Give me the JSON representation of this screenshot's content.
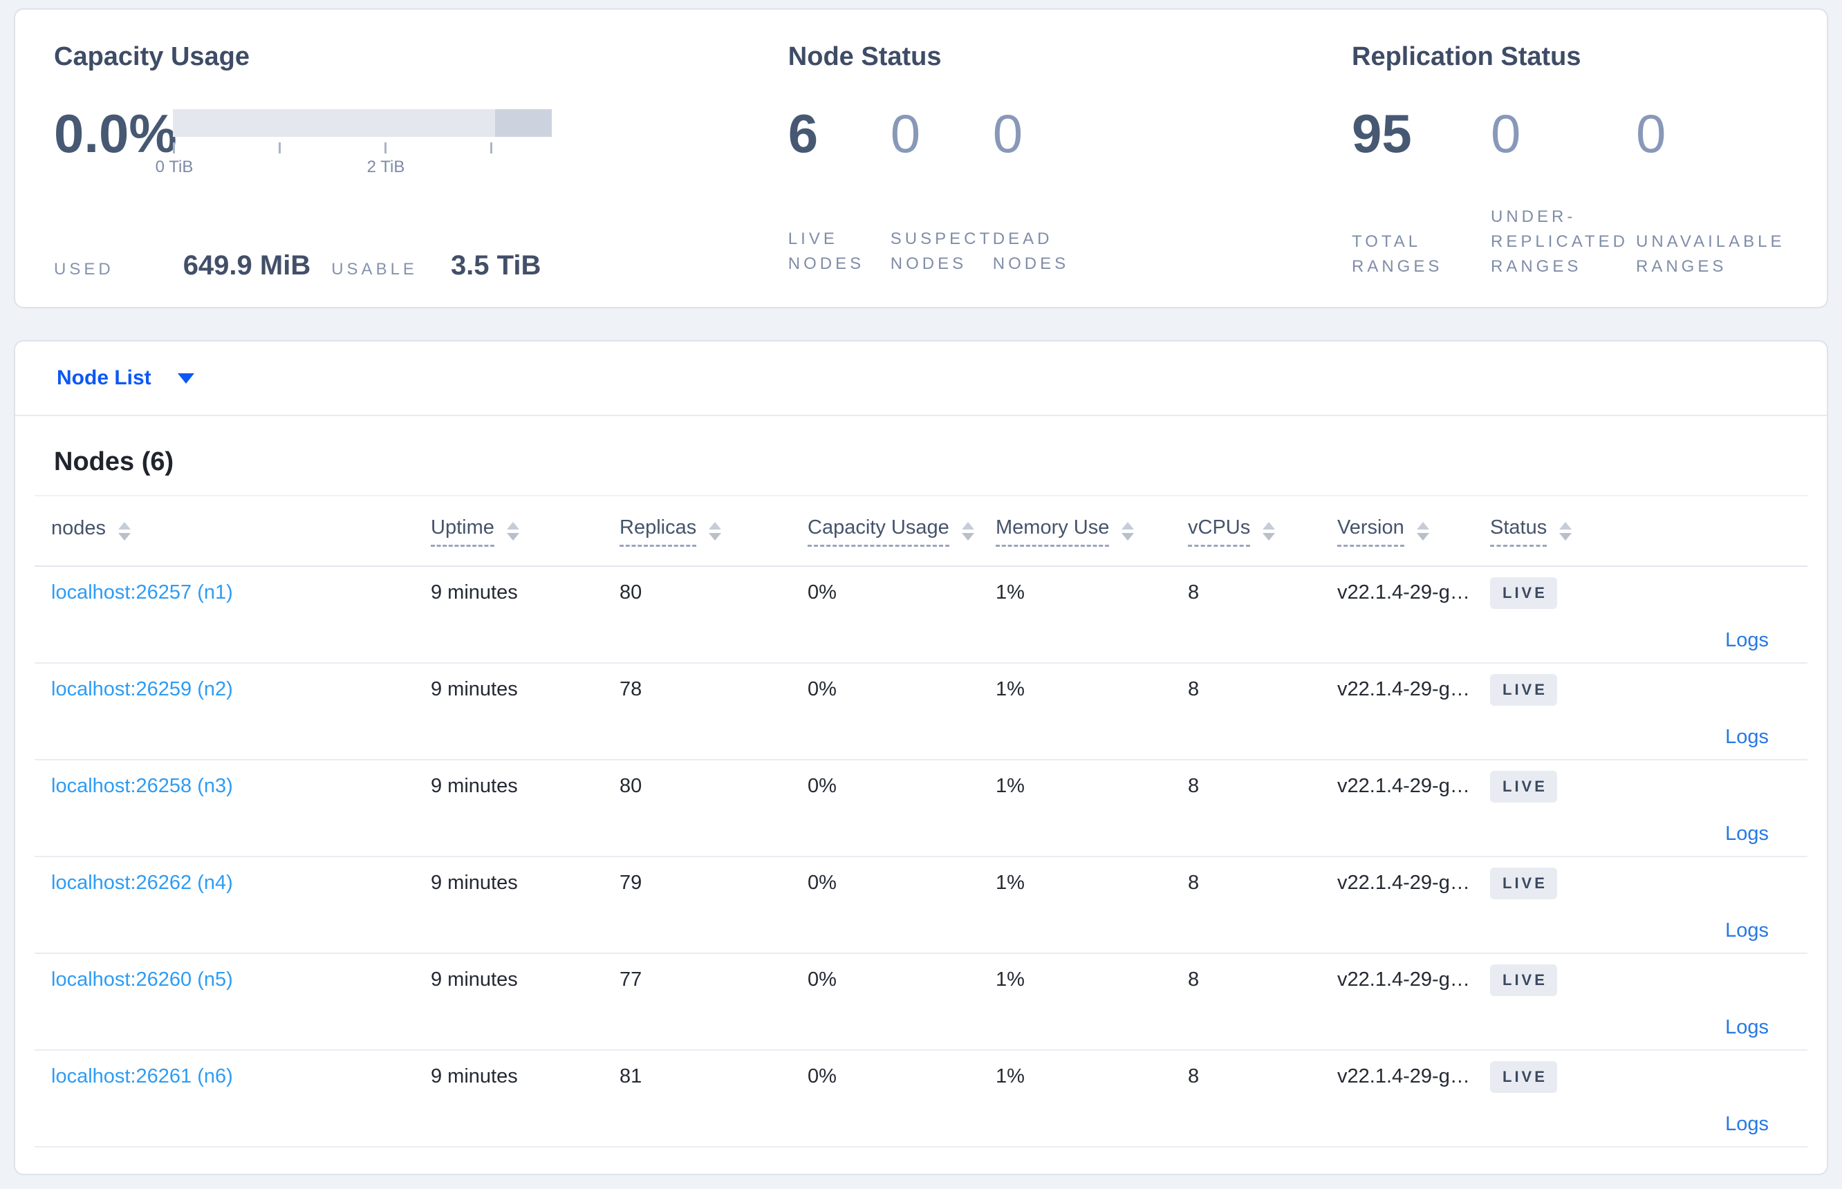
{
  "overview": {
    "capacity_usage": {
      "title": "Capacity Usage",
      "percent": "0.0%",
      "axis_ticks": [
        "0 TiB",
        "2 TiB"
      ],
      "used_label": "USED",
      "used_value": "649.9 MiB",
      "usable_label": "USABLE",
      "usable_value": "3.5 TiB"
    },
    "node_status": {
      "title": "Node Status",
      "stats": [
        {
          "value": "6",
          "label": "LIVE NODES"
        },
        {
          "value": "0",
          "label": "SUSPECT NODES"
        },
        {
          "value": "0",
          "label": "DEAD NODES"
        }
      ]
    },
    "replication_status": {
      "title": "Replication Status",
      "stats": [
        {
          "value": "95",
          "label": "TOTAL RANGES"
        },
        {
          "value": "0",
          "label": "UNDER-REPLICATED RANGES"
        },
        {
          "value": "0",
          "label": "UNAVAILABLE RANGES"
        }
      ]
    }
  },
  "view_selector": {
    "selected": "Node List",
    "icon": "caret-down-icon"
  },
  "nodes": {
    "title": "Nodes (6)",
    "columns": [
      {
        "label": "nodes"
      },
      {
        "label": "Uptime"
      },
      {
        "label": "Replicas"
      },
      {
        "label": "Capacity Usage"
      },
      {
        "label": "Memory Use"
      },
      {
        "label": "vCPUs"
      },
      {
        "label": "Version"
      },
      {
        "label": "Status"
      }
    ],
    "rows": [
      {
        "node": "localhost:26257 (n1)",
        "uptime": "9 minutes",
        "replicas": "80",
        "capacity": "0%",
        "memory": "1%",
        "vcpus": "8",
        "version": "v22.1.4-29-g…",
        "status": "LIVE",
        "logs": "Logs"
      },
      {
        "node": "localhost:26259 (n2)",
        "uptime": "9 minutes",
        "replicas": "78",
        "capacity": "0%",
        "memory": "1%",
        "vcpus": "8",
        "version": "v22.1.4-29-g…",
        "status": "LIVE",
        "logs": "Logs"
      },
      {
        "node": "localhost:26258 (n3)",
        "uptime": "9 minutes",
        "replicas": "80",
        "capacity": "0%",
        "memory": "1%",
        "vcpus": "8",
        "version": "v22.1.4-29-g…",
        "status": "LIVE",
        "logs": "Logs"
      },
      {
        "node": "localhost:26262 (n4)",
        "uptime": "9 minutes",
        "replicas": "79",
        "capacity": "0%",
        "memory": "1%",
        "vcpus": "8",
        "version": "v22.1.4-29-g…",
        "status": "LIVE",
        "logs": "Logs"
      },
      {
        "node": "localhost:26260 (n5)",
        "uptime": "9 minutes",
        "replicas": "77",
        "capacity": "0%",
        "memory": "1%",
        "vcpus": "8",
        "version": "v22.1.4-29-g…",
        "status": "LIVE",
        "logs": "Logs"
      },
      {
        "node": "localhost:26261 (n6)",
        "uptime": "9 minutes",
        "replicas": "81",
        "capacity": "0%",
        "memory": "1%",
        "vcpus": "8",
        "version": "v22.1.4-29-g…",
        "status": "LIVE",
        "logs": "Logs"
      }
    ]
  },
  "colors": {
    "link": "#2d9cf4",
    "logs_link": "#2679e3",
    "nav_link": "#0b58f5",
    "badge_bg": "#e8ecf2",
    "badge_text": "#3c485e",
    "bar_track": "#e4e7ee",
    "bar_segment": "#cdd3de"
  }
}
